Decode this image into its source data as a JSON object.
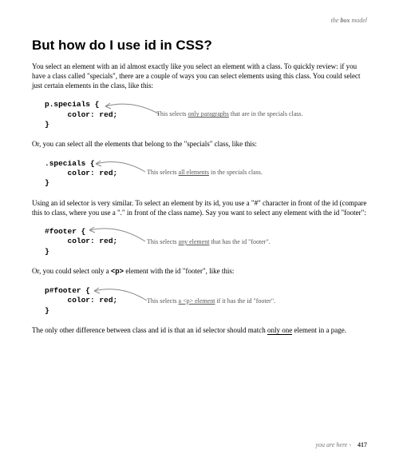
{
  "header": {
    "pre": "the ",
    "bold": "box",
    "post": " model"
  },
  "title": "But how do I use id in CSS?",
  "intro": "You select an element with an id almost exactly like you select an element with a class. To quickly review: if you have a class called \"specials\", there are a couple of ways you can select elements using this class. You could select just certain elements in the class, like this:",
  "code1": "p.specials {\n     color: red;\n}",
  "ann1_pre": "This selects ",
  "ann1_u": "only paragraphs",
  "ann1_post": " that are in the specials class.",
  "para2": "Or, you can select all the elements that belong to the \"specials\" class, like this:",
  "code2": ".specials {\n     color: red;\n}",
  "ann2_pre": "This selects ",
  "ann2_u": "all elements",
  "ann2_post": " in the specials class.",
  "para3": "Using an id selector is very similar.  To select an element by its id, you use a \"#\" character in front of the id (compare this to class, where you use a \".\" in front of the class name). Say you want to select any element with the id \"footer\":",
  "code3": "#footer {\n     color: red;\n}",
  "ann3_pre": "This selects ",
  "ann3_u": "any element",
  "ann3_post": " that has the id \"footer\".",
  "para4_pre": "Or, you could select only a ",
  "para4_mono": "<p>",
  "para4_post": " element with the id \"footer\", like this:",
  "code4": "p#footer {\n     color: red;\n}",
  "ann4_pre": "This selects ",
  "ann4_u": "a <p> element",
  "ann4_post": " if it has the id \"footer\".",
  "para5_a": "The only other difference between class and id is that an id selector should match ",
  "para5_u": "only one",
  "para5_b": " element in a page.",
  "footer": {
    "text": "you are here ",
    "arrow": "›",
    "page": "417"
  }
}
